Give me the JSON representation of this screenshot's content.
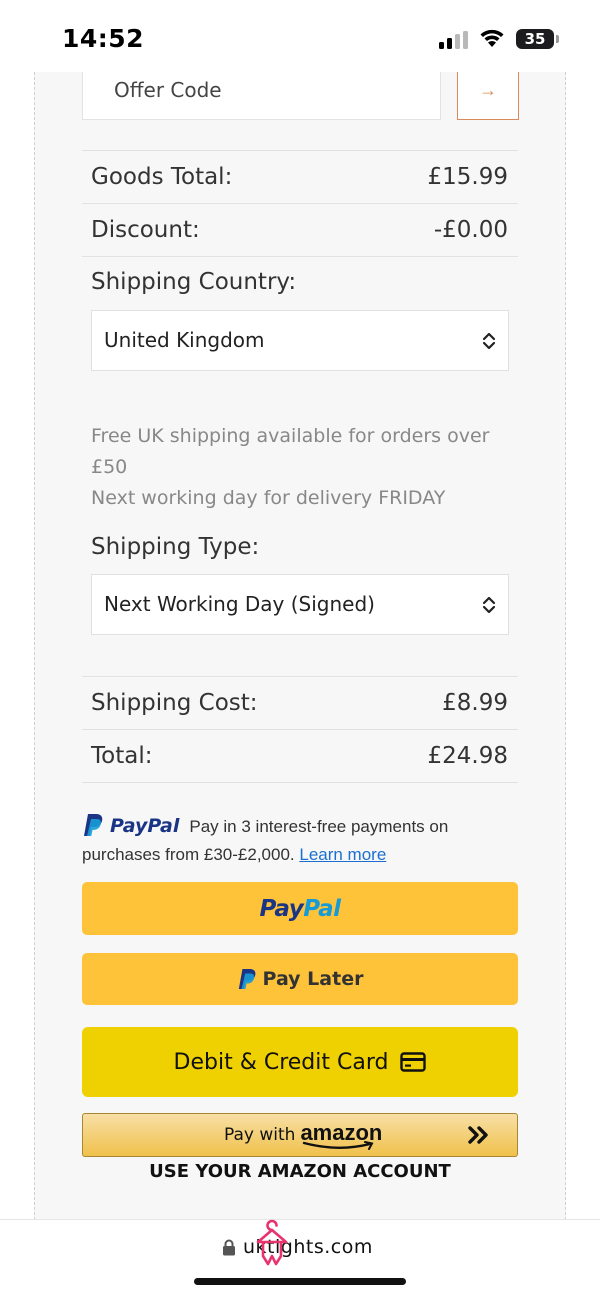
{
  "status_bar": {
    "time": "14:52",
    "battery": "35",
    "icons": [
      "cellular-signal-icon",
      "wifi-icon",
      "battery-icon"
    ]
  },
  "offer": {
    "placeholder": "Offer Code",
    "submit_icon": "arrow-right-icon",
    "submit_glyph": "→"
  },
  "summary": {
    "goods_total_label": "Goods Total:",
    "goods_total_value": "£15.99",
    "discount_label": "Discount:",
    "discount_value": "-£0.00"
  },
  "shipping_country": {
    "label": "Shipping Country:",
    "selected": "United Kingdom"
  },
  "shipping_notes": {
    "line1": "Free UK shipping available for orders over £50",
    "line2": "Next working day for delivery FRIDAY"
  },
  "shipping_type": {
    "label": "Shipping Type:",
    "selected": "Next Working Day (Signed)"
  },
  "totals": {
    "shipping_cost_label": "Shipping Cost:",
    "shipping_cost_value": "£8.99",
    "total_label": "Total:",
    "total_value": "£24.98"
  },
  "paypal_message": {
    "brand": "PayPal",
    "text": "Pay in 3 interest-free payments on purchases from £30-£2,000.",
    "link": "Learn more"
  },
  "buttons": {
    "paypal_part1": "Pay",
    "paypal_part2": "Pal",
    "pay_later": "Pay Later",
    "card": "Debit & Credit Card",
    "amazon_prefix": "Pay with",
    "amazon_brand": "amazon"
  },
  "amazon_caption": "USE YOUR AMAZON ACCOUNT",
  "browser": {
    "url": "uktights.com"
  },
  "colors": {
    "paypal_yellow": "#ffc339",
    "card_yellow": "#efd000",
    "paypal_dark_blue": "#1a3486",
    "paypal_light_blue": "#179bd7",
    "offer_accent": "#d9895a",
    "link_blue": "#1c6fd1",
    "brand_pink": "#e8336f"
  }
}
